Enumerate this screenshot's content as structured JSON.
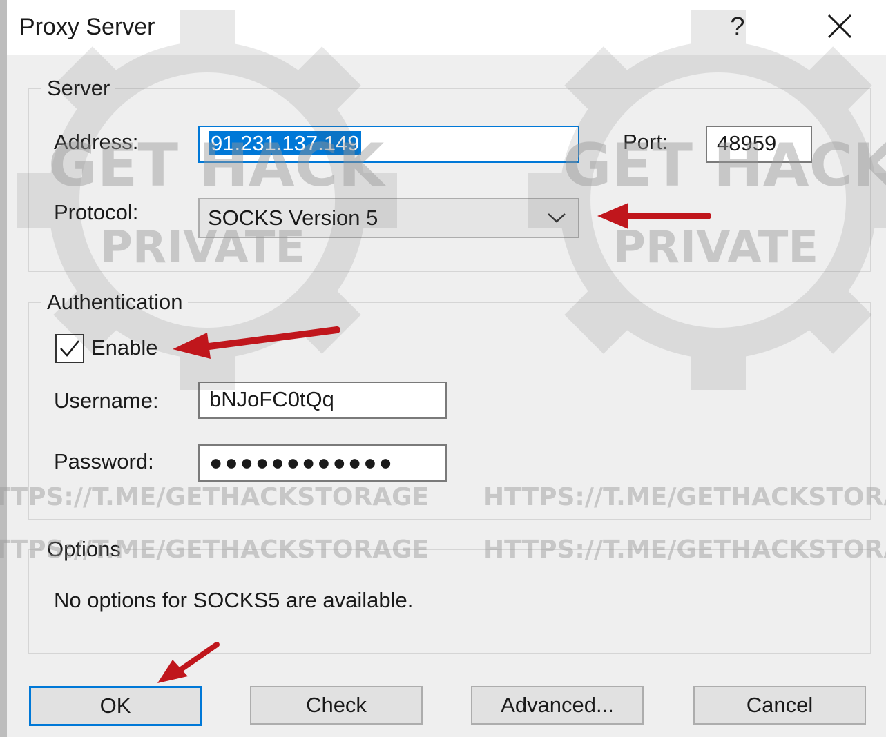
{
  "window": {
    "title": "Proxy Server",
    "help_label": "?",
    "close_icon": "close-icon"
  },
  "server": {
    "legend": "Server",
    "address_label": "Address:",
    "address_value": "91.231.137.149",
    "port_label": "Port:",
    "port_value": "48959",
    "protocol_label": "Protocol:",
    "protocol_value": "SOCKS Version 5"
  },
  "authentication": {
    "legend": "Authentication",
    "enable_label": "Enable",
    "enable_checked": true,
    "username_label": "Username:",
    "username_value": "bNJoFC0tQq",
    "password_label": "Password:",
    "password_value": "●●●●●●●●●●●●"
  },
  "options": {
    "legend": "Options",
    "message": "No options for SOCKS5 are available."
  },
  "buttons": {
    "ok": "OK",
    "check": "Check",
    "advanced": "Advanced...",
    "cancel": "Cancel"
  },
  "watermark": {
    "brand_line1": "GET HACK",
    "brand_line2": "PRIVATE",
    "url": "HTTPS://T.ME/GETHACKSTORAGE"
  },
  "colors": {
    "accent": "#0078d7",
    "annotation_arrow": "#c0161c"
  }
}
